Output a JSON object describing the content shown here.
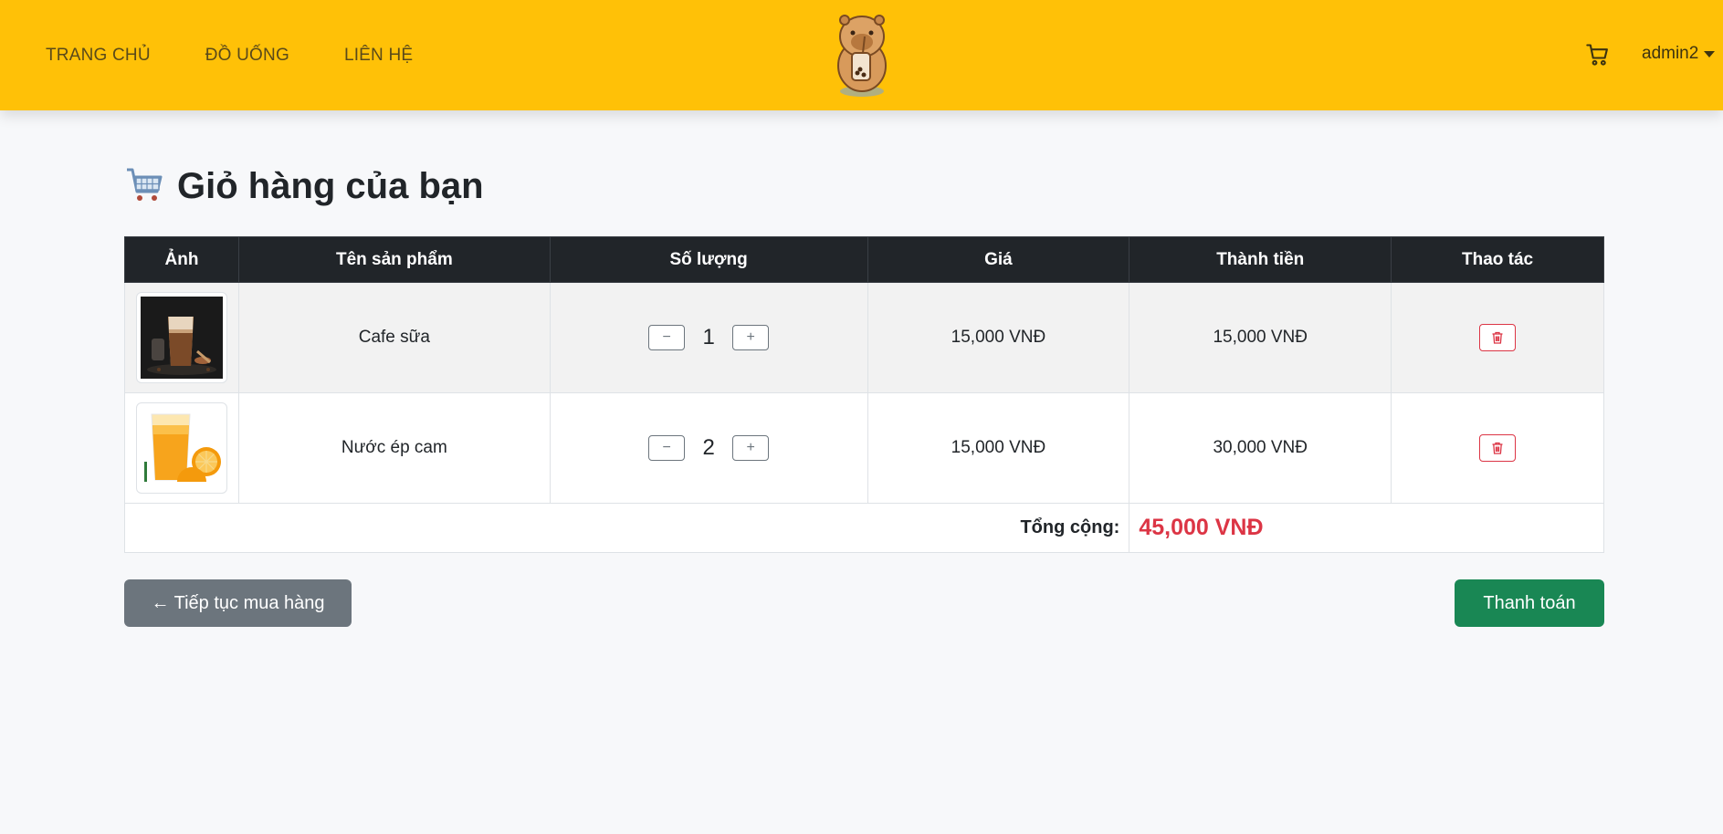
{
  "nav": {
    "links": [
      "TRANG CHỦ",
      "ĐỒ UỐNG",
      "LIÊN HỆ"
    ],
    "user": "admin2",
    "logo_icon": "capybara-bubble-tea-logo",
    "cart_icon": "cart-icon"
  },
  "page": {
    "title": "Giỏ hàng của bạn",
    "title_icon": "shopping-cart-emoji"
  },
  "table": {
    "headers": [
      "Ảnh",
      "Tên sản phẩm",
      "Số lượng",
      "Giá",
      "Thành tiền",
      "Thao tác"
    ],
    "rows": [
      {
        "name": "Cafe sữa",
        "qty": "1",
        "price": "15,000 VNĐ",
        "subtotal": "15,000 VNĐ",
        "image": "iced-milk-coffee"
      },
      {
        "name": "Nước ép cam",
        "qty": "2",
        "price": "15,000 VNĐ",
        "subtotal": "30,000 VNĐ",
        "image": "orange-juice"
      }
    ],
    "qty_minus": "−",
    "qty_plus": "+",
    "total_label": "Tổng cộng:",
    "total_value": "45,000 VNĐ"
  },
  "actions": {
    "back": "← Tiếp tục mua hàng",
    "checkout": "Thanh toán"
  },
  "colors": {
    "navbar": "#ffc107",
    "table_header": "#212529",
    "danger": "#dc3545",
    "success": "#198754",
    "secondary": "#6c757d"
  }
}
